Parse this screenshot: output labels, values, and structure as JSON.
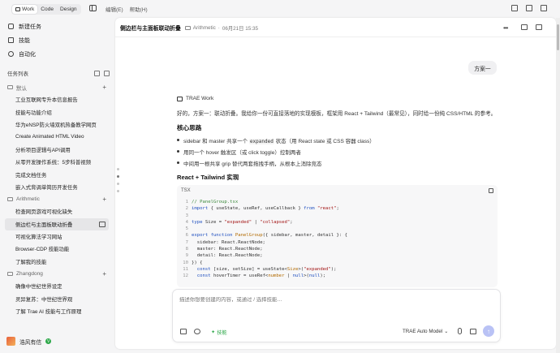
{
  "topbar": {
    "modes": [
      {
        "label": "Work",
        "active": true
      },
      {
        "label": "Code",
        "active": false
      },
      {
        "label": "Design",
        "active": false
      }
    ],
    "menu": [
      "编辑(E)",
      "帮助(H)"
    ]
  },
  "sidebar": {
    "nav": [
      {
        "label": "新建任务",
        "icon": "new-task-icon"
      },
      {
        "label": "技能",
        "icon": "skills-icon"
      },
      {
        "label": "自动化",
        "icon": "automation-icon"
      }
    ],
    "list_title": "任务列表",
    "groups": [
      {
        "name": "默认",
        "tasks": [
          "工业互联网专升本信息报告",
          "技能与功能介绍",
          "华为eNSP防火墙双机热备教学网页",
          "Create Animated HTML Video",
          "分析项目逻辑与API调用",
          "从零开发操作系统：5步科普视频",
          "完成文档任务",
          "嵌入式背调单简历开发任务"
        ]
      },
      {
        "name": "Arithmetic",
        "tasks": [
          "检查网页游戏可视化缺失",
          "侧边栏与主面板联动折叠",
          "可视化算法学习网站",
          "Browser-CDP 技能功能",
          "了解我的技能"
        ]
      },
      {
        "name": "Zhangdong",
        "tasks": [
          "确像中世纪世界设定",
          "灵异复苏：中世纪世界观",
          "了解 Trae AI 技能与工作原理"
        ]
      }
    ],
    "selected_task": "侧边栏与主面板联动折叠",
    "user": {
      "name": "浩风有信",
      "badge": "V"
    }
  },
  "main": {
    "title": "侧边栏与主面板联动折叠",
    "crumb_folder": "Arithmetic",
    "crumb_date": "06月21日 15:35",
    "user_message": "方案一",
    "assistant_name": "TRAE Work",
    "intro": "好的，方案一：联动折叠。我给你一份可直接落地的实现模板，框架用 React + Tailwind（最常见），同时给一份纯 CSS/HTML 的参考。",
    "heading_core": "核心思路",
    "bullets": [
      {
        "pre": "sidebar 和 master 共享一个 ",
        "code": "expanded",
        "post": " 状态（用 React state 或 CSS 容器 class）"
      },
      {
        "pre": "用同一个 hover 触发区（或 click toggle）控制两者",
        "code": "",
        "post": ""
      },
      {
        "pre": "中间用一根共享 grip 替代两套拖拽手柄，从根本上消除竞态",
        "code": "",
        "post": ""
      }
    ],
    "heading_impl": "React + Tailwind 实现",
    "code_lang": "TSX",
    "code_lines": [
      [
        {
          "t": "// PanelGroup.tsx",
          "c": "c-comment"
        }
      ],
      [
        {
          "t": "import",
          "c": "c-kw"
        },
        {
          "t": " { useState, useRef, useCallback } ",
          "c": "ct"
        },
        {
          "t": "from",
          "c": "c-kw"
        },
        {
          "t": " \"react\"",
          "c": "c-str"
        },
        {
          "t": ";",
          "c": "ct"
        }
      ],
      [
        {
          "t": "",
          "c": "ct"
        }
      ],
      [
        {
          "t": "type",
          "c": "c-kw"
        },
        {
          "t": " Size = ",
          "c": "ct"
        },
        {
          "t": "\"expanded\"",
          "c": "c-str"
        },
        {
          "t": " | ",
          "c": "ct"
        },
        {
          "t": "\"collapsed\"",
          "c": "c-str"
        },
        {
          "t": ";",
          "c": "ct"
        }
      ],
      [
        {
          "t": "",
          "c": "ct"
        }
      ],
      [
        {
          "t": "export function",
          "c": "c-kw"
        },
        {
          "t": " ",
          "c": "ct"
        },
        {
          "t": "PanelGroup",
          "c": "c-type"
        },
        {
          "t": "({ sidebar, master, detail }: {",
          "c": "ct"
        }
      ],
      [
        {
          "t": "  sidebar: React.ReactNode;",
          "c": "ct"
        }
      ],
      [
        {
          "t": "  master: React.ReactNode;",
          "c": "ct"
        }
      ],
      [
        {
          "t": "  detail: React.ReactNode;",
          "c": "ct"
        }
      ],
      [
        {
          "t": "}) {",
          "c": "ct"
        }
      ],
      [
        {
          "t": "  const",
          "c": "c-kw"
        },
        {
          "t": " [size, setSize] = useState<",
          "c": "ct"
        },
        {
          "t": "Size",
          "c": "c-type"
        },
        {
          "t": ">(",
          "c": "ct"
        },
        {
          "t": "\"expanded\"",
          "c": "c-str"
        },
        {
          "t": ");",
          "c": "ct"
        }
      ],
      [
        {
          "t": "  const",
          "c": "c-kw"
        },
        {
          "t": " hoverTimer = useRef<",
          "c": "ct"
        },
        {
          "t": "number",
          "c": "c-type"
        },
        {
          "t": " | ",
          "c": "ct"
        },
        {
          "t": "null",
          "c": "c-kw"
        },
        {
          "t": ">(",
          "c": "ct"
        },
        {
          "t": "null",
          "c": "c-kw"
        },
        {
          "t": ");",
          "c": "ct"
        }
      ]
    ],
    "composer": {
      "placeholder": "描述你想要创建的内容，或通过 / 选择技能…",
      "skill_label": "技能",
      "model_label": "TRAE Auto Model"
    }
  },
  "colors": {
    "accent": "#2ea84a",
    "send": "#b9c2f5",
    "selected_row": "#e6e6e8"
  }
}
